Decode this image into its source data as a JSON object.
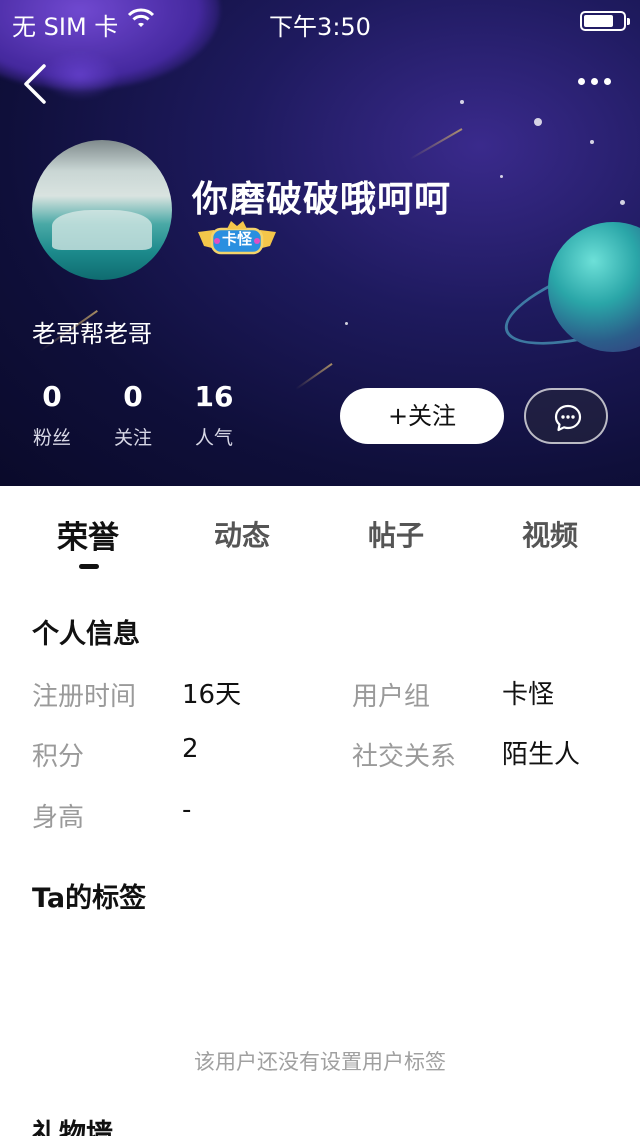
{
  "status_bar": {
    "carrier": "无 SIM 卡",
    "time": "下午3:50",
    "battery_level": 0.75
  },
  "profile": {
    "username": "你磨破破哦呵呵",
    "badge_label": "卡怪",
    "bio": "老哥帮老哥",
    "stats": [
      {
        "value": "0",
        "label": "粉丝"
      },
      {
        "value": "0",
        "label": "关注"
      },
      {
        "value": "16",
        "label": "人气"
      }
    ],
    "follow_label": "+关注"
  },
  "tabs": [
    {
      "label": "荣誉",
      "active": true
    },
    {
      "label": "动态",
      "active": false
    },
    {
      "label": "帖子",
      "active": false
    },
    {
      "label": "视频",
      "active": false
    }
  ],
  "personal_info": {
    "title": "个人信息",
    "fields": [
      {
        "label": "注册时间",
        "value": "16天"
      },
      {
        "label": "用户组",
        "value": "卡怪"
      },
      {
        "label": "积分",
        "value": "2"
      },
      {
        "label": "社交关系",
        "value": "陌生人"
      },
      {
        "label": "身高",
        "value": "-"
      }
    ]
  },
  "tags": {
    "title": "Ta的标签",
    "empty_text": "该用户还没有设置用户标签"
  },
  "gifts": {
    "title": "礼物墙"
  },
  "icons": {
    "back": "back-arrow-icon",
    "more": "more-dots-icon",
    "chat": "chat-bubble-icon",
    "wifi": "wifi-icon",
    "battery": "battery-icon"
  }
}
